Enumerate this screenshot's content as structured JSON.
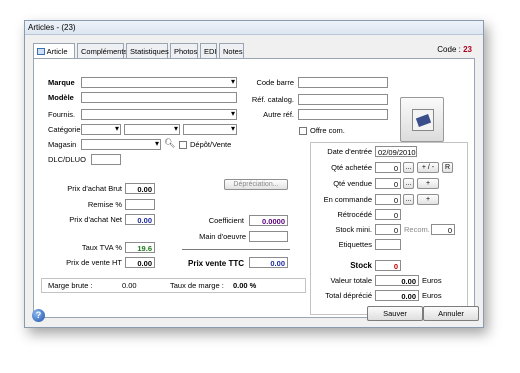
{
  "window": {
    "title": "Articles - (23)"
  },
  "tabs": [
    "Article",
    "Compléments",
    "Statistiques",
    "Photos",
    "EDI",
    "Notes"
  ],
  "code": {
    "label": "Code :",
    "value": "23"
  },
  "left": {
    "marque": "Marque",
    "modele": "Modèle",
    "fournis": "Fournis.",
    "categorie": "Catégorie",
    "magasin": "Magasin",
    "depot": "Dépôt/Vente",
    "dlc": "DLC/DLUO",
    "prix_achat_brut_label": "Prix d'achat  Brut",
    "prix_achat_brut": "0.00",
    "remise_label": "Remise  %",
    "prix_achat_net_label": "Prix d'achat  Net",
    "prix_achat_net": "0.00",
    "depreciation": "Dépréciation...",
    "coefficient_label": "Coefficient",
    "coefficient": "0.0000",
    "main_oeuvre_label": "Main d'oeuvre",
    "tva_label": "Taux TVA  %",
    "tva": "19.6",
    "prix_vente_ht_label": "Prix de vente  HT",
    "prix_vente_ht": "0.00",
    "prix_vente_ttc_label": "Prix vente  TTC",
    "prix_vente_ttc": "0.00",
    "marge_brute_label": "Marge brute :",
    "marge_brute": "0.00",
    "taux_marge_label": "Taux de marge :",
    "taux_marge": "0.00 %"
  },
  "right": {
    "code_barre": "Code barre",
    "ref_catalog": "Réf. catalog.",
    "autre_ref": "Autre réf.",
    "offre": "Offre com.",
    "date_entree_label": "Date d'entrée",
    "date_entree": "02/09/2010",
    "qte_achetee_label": "Qté achetée",
    "qte_achetee": "0",
    "qte_vendue_label": "Qté vendue",
    "qte_vendue": "0",
    "en_commande_label": "En commande",
    "en_commande": "0",
    "retrocede_label": "Rétrocédé",
    "retrocede": "0",
    "stock_mini_label": "Stock mini.",
    "stock_mini": "0",
    "recom_label": "Recom.",
    "recom": "0",
    "etiquettes_label": "Etiquettes",
    "stock_label": "Stock",
    "stock": "0",
    "valeur_totale_label": "Valeur totale",
    "valeur_totale": "0.00",
    "total_deprecie_label": "Total déprécié",
    "total_deprecie": "0.00",
    "euros": "Euros",
    "btn_dots": "...",
    "btn_plusminus": "+ / -",
    "btn_r": "R",
    "btn_plus": "+"
  },
  "footer": {
    "save": "Sauver",
    "cancel": "Annuler",
    "help": "?"
  }
}
